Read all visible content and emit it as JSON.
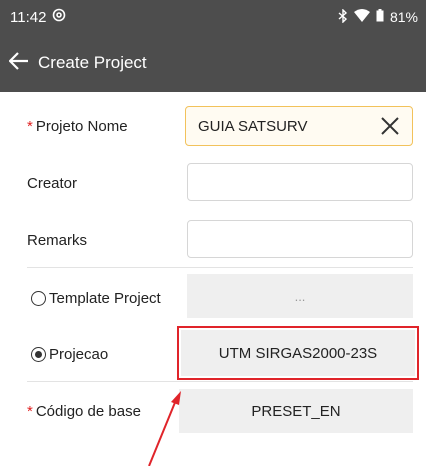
{
  "status_bar": {
    "time": "11:42",
    "battery_percent": "81%",
    "icons": [
      "at-sign-icon",
      "bluetooth-icon",
      "wifi-icon",
      "battery-icon"
    ]
  },
  "app_bar": {
    "title": "Create Project",
    "back_icon": "arrow-left-icon"
  },
  "form": {
    "project_name": {
      "required": true,
      "required_mark": "*",
      "label": "Projeto Nome",
      "value": "GUIA SATSURV",
      "clear_icon": "close-icon"
    },
    "creator": {
      "label": "Creator",
      "value": ""
    },
    "remarks": {
      "label": "Remarks",
      "value": ""
    },
    "template_project": {
      "label": "Template Project",
      "selected": false,
      "value": "..."
    },
    "projecao": {
      "label": "Projecao",
      "selected": true,
      "value": "UTM SIRGAS2000-23S"
    },
    "codigo_base": {
      "required": true,
      "required_mark": "*",
      "label": "Código de base",
      "value": "PRESET_EN"
    }
  },
  "annotation": {
    "color": "#e0242a",
    "type": "highlight-box-and-arrow"
  },
  "colors": {
    "header_bg": "#4d4d4d",
    "required": "#e02020",
    "focus_border": "#f2c25b"
  }
}
